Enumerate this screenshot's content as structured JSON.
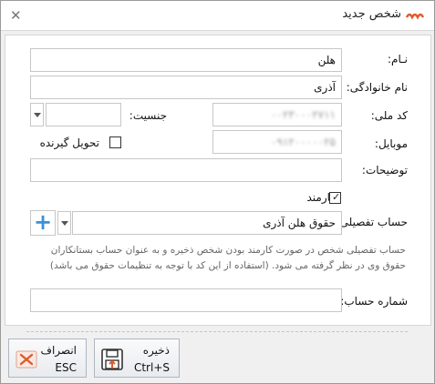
{
  "window": {
    "title": "شخص جدید",
    "close_glyph": "✕",
    "logo_icon": "sepidar-logo"
  },
  "form": {
    "first_name": {
      "label": "نـام:",
      "value": "هلن"
    },
    "last_name": {
      "label": "نام خانوادگی:",
      "value": "آذری"
    },
    "national_code": {
      "label": "کد ملی:",
      "value": "۰۰۲۳۰۰۰۲۷۱۱"
    },
    "gender": {
      "label": "جنسیت:",
      "value": ""
    },
    "mobile": {
      "label": "موبایل:",
      "value": "۰۹۱۲۰۰۰۰۰۲۵"
    },
    "receiver": {
      "label": "تحویل گیرنده",
      "checked": false
    },
    "description": {
      "label": "توضیحات:",
      "value": ""
    },
    "employee": {
      "label": "کارمند",
      "checked": true
    },
    "detail_account": {
      "label": "حساب تفصیلی:",
      "value": "حقوق هلن آذری"
    },
    "hint": "حساب تفصیلی شخص در صورت کارمند بودن شخص ذخیره و به عنوان حساب بستانکاران حقوق وی در نظر گرفته می شود. (استفاده از این کد با توجه به تنظیمات حقوق می باشد)",
    "account_number": {
      "label": "شماره حساب:",
      "value": ""
    }
  },
  "buttons": {
    "save": {
      "label": "ذخیره",
      "shortcut": "Ctrl+S"
    },
    "cancel": {
      "label": "انصراف",
      "shortcut": "ESC"
    }
  },
  "colors": {
    "accent": "#e05a2b",
    "plus": "#3b8fd6"
  }
}
